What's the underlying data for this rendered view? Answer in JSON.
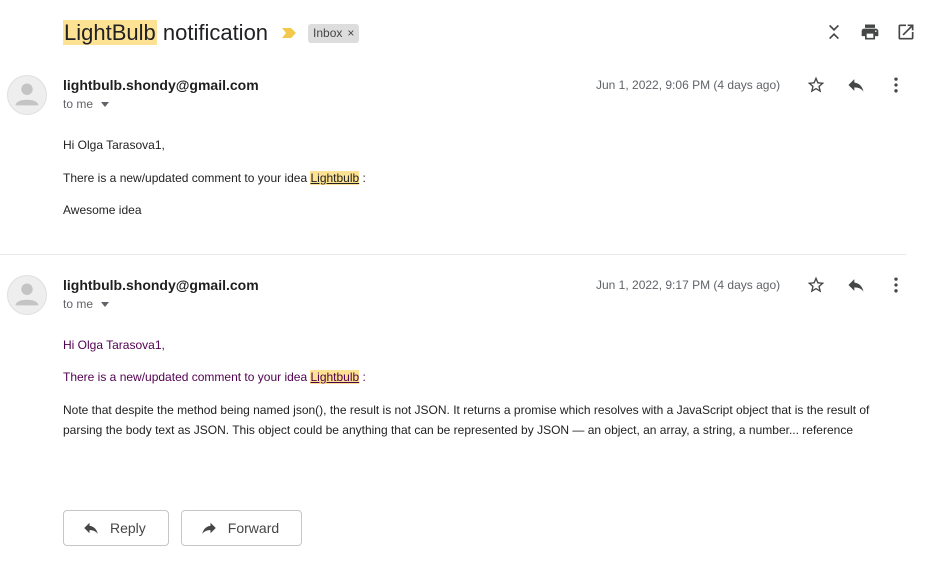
{
  "subject": {
    "highlight": "LightBulb",
    "rest": " notification",
    "label_chip": "Inbox",
    "label_close": "×"
  },
  "messages": [
    {
      "sender": "lightbulb.shondy@gmail.com",
      "recipient": "to me",
      "date": "Jun 1, 2022, 9:06 PM (4 days ago)",
      "greeting": "Hi Olga Tarasova1,",
      "line_prefix": "There is a new/updated comment to your idea ",
      "idea_link": "Lightbulb",
      "line_suffix": " :",
      "comment": "Awesome idea"
    },
    {
      "sender": "lightbulb.shondy@gmail.com",
      "recipient": "to me",
      "date": "Jun 1, 2022, 9:17 PM (4 days ago)",
      "greeting": "Hi Olga Tarasova1,",
      "line_prefix": "There is a new/updated comment to your idea ",
      "idea_link": "Lightbulb",
      "line_suffix": " :",
      "comment": "Note that despite the method being named json(), the result is not JSON. It returns a promise which resolves with a JavaScript object that is the result of parsing the body text as JSON. This object could be anything that can be represented by JSON — an object, an array, a string, a number... reference"
    }
  ],
  "actions": {
    "reply": "Reply",
    "forward": "Forward"
  },
  "colors": {
    "highlight": "#fde293",
    "quoted_text": "#500050",
    "importance": "#f2c94c"
  },
  "icons": [
    "importance-marker-icon",
    "collapse-all-icon",
    "print-icon",
    "open-new-window-icon",
    "star-icon",
    "reply-icon",
    "more-vert-icon",
    "forward-icon",
    "avatar-icon"
  ]
}
